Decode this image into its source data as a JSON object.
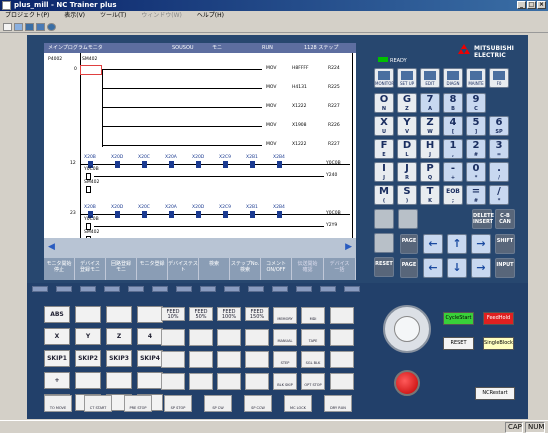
{
  "window": {
    "title": "plus_mill - NC Trainer plus",
    "buttons": [
      "_",
      "□",
      "×"
    ]
  },
  "menu": [
    "プロジェクト(P)",
    "表示(V)",
    "ツール(T)",
    "ウィンドウ(W)",
    "ヘルプ(H)"
  ],
  "screen": {
    "header": {
      "left": "メインプログラムモニタ",
      "sousou": "SOUSOU",
      "mode": "モニ",
      "run": "RUN",
      "step": "1128 ステップ"
    },
    "program_label": "P4002",
    "rungs": [
      {
        "num": "0",
        "contact": "SM402",
        "instr": "MOV",
        "src": "H8FFFF",
        "dst": "R224"
      },
      {
        "num": "",
        "contact": "",
        "instr": "MOV",
        "src": "H4131",
        "dst": "R225"
      },
      {
        "num": "",
        "contact": "",
        "instr": "MOV",
        "src": "X1222",
        "dst": "R227"
      },
      {
        "num": "",
        "contact": "",
        "instr": "MOV",
        "src": "X1908",
        "dst": "R226"
      },
      {
        "num": "",
        "contact": "",
        "instr": "MOV",
        "src": "X1222",
        "dst": "R227"
      },
      {
        "num": "12",
        "contacts": [
          "X20B",
          "X20D",
          "X20C",
          "X20A",
          "X20D",
          "X2C9",
          "X2B1",
          "X2B4"
        ],
        "coil": "Y0C0B"
      },
      {
        "num": "",
        "contacts": [
          "Y0C0B"
        ],
        "coil": "Y240"
      },
      {
        "num": "",
        "contacts": [
          "SM402"
        ]
      },
      {
        "num": "23",
        "contacts": [
          "X20B",
          "X20D",
          "X20C",
          "X20A",
          "X20D",
          "X2C9",
          "X2B1",
          "X2B4"
        ],
        "coil": "Y0C0B"
      },
      {
        "num": "",
        "contacts": [
          "Y0C0B"
        ],
        "coil": "Y2Y9"
      },
      {
        "num": "",
        "contacts": [
          "SM402"
        ]
      },
      {
        "num": "33",
        "contacts": [
          "X20B",
          "X20D",
          "X20C",
          "X20A",
          "X20D",
          "X2C9",
          "X2B1",
          "X2B4"
        ],
        "coil": "M500"
      }
    ],
    "softkeys": [
      "モニタ開始\n停止",
      "デバイス\n登録モニ",
      "回路登録\nモニ",
      "モニタ登録",
      "デバイステスト",
      "検索",
      "ステップNo.\n検索",
      "コメント\nON/OFF",
      "伝送開始\n確認",
      "デバイス\n一括"
    ]
  },
  "status": {
    "ready": "READY"
  },
  "brand": {
    "name": "MITSUBISHI",
    "sub": "ELECTRIC"
  },
  "function_keys": [
    "MONITOR",
    "SET UP",
    "EDIT",
    "DIAGN",
    "MAINTE",
    "F0"
  ],
  "keypad": [
    {
      "main": "O",
      "sub": "N"
    },
    {
      "main": "G",
      "sub": "Z"
    },
    {
      "main": "7",
      "sub": "A"
    },
    {
      "main": "8",
      "sub": "B"
    },
    {
      "main": "9",
      "sub": "C"
    },
    {
      "main": "X",
      "sub": "U"
    },
    {
      "main": "Y",
      "sub": "V"
    },
    {
      "main": "Z",
      "sub": "W"
    },
    {
      "main": "4",
      "sub": "["
    },
    {
      "main": "5",
      "sub": "]"
    },
    {
      "main": "6",
      "sub": "SP"
    },
    {
      "main": "F",
      "sub": "E"
    },
    {
      "main": "D",
      "sub": "L"
    },
    {
      "main": "H",
      "sub": "J"
    },
    {
      "main": "1",
      "sub": ","
    },
    {
      "main": "2",
      "sub": "#"
    },
    {
      "main": "3",
      "sub": "="
    },
    {
      "main": "I",
      "sub": "J"
    },
    {
      "main": "J",
      "sub": "R"
    },
    {
      "main": "P",
      "sub": "Q"
    },
    {
      "main": "-",
      "sub": "+"
    },
    {
      "main": "0",
      "sub": "*"
    },
    {
      "main": ".",
      "sub": "/"
    },
    {
      "main": "M",
      "sub": "("
    },
    {
      "main": "S",
      "sub": ")"
    },
    {
      "main": "T",
      "sub": "K"
    },
    {
      "main": "EOB",
      "sub": ";"
    },
    {
      "main": "=",
      "sub": "#"
    },
    {
      "main": "/",
      "sub": "*"
    }
  ],
  "edit_keys": [
    "DELETE\nINSERT",
    "C-B\nCAN",
    "SHIFT",
    "RESET",
    "PAGE",
    "PAGE",
    "INPUT"
  ],
  "operation": {
    "abs": "ABS",
    "x": "X",
    "y": "Y",
    "z": "Z",
    "4": "4",
    "skip": [
      "SKIP1",
      "SKIP2",
      "SKIP3",
      "SKIP4"
    ],
    "plus": "+",
    "minus": "-",
    "feed": [
      "FEED\n10%",
      "FEED\n50%",
      "FEED\n100%",
      "FEED\n150%"
    ],
    "rapid": [
      "1%",
      "25%",
      "50%",
      "100%"
    ],
    "modes": [
      "MEMORY",
      "MDI",
      "MANUAL",
      "TAPE",
      "STEP",
      "SGL BLK",
      "BLK SKIP",
      "OPT STOP"
    ],
    "misc": [
      "TO MOVE",
      "CT START",
      "PRE STOP",
      "SP STOP",
      "SP CW",
      "SP CCW",
      "MC LOCK",
      "DRY RUN"
    ]
  },
  "side_buttons": {
    "cycle_start": "CycleStart",
    "feed_hold": "FeedHold",
    "reset": "RESET",
    "single_block": "SingleBlock",
    "nc_restart": "NCRestart"
  },
  "statusbar": {
    "cap": "CAP",
    "num": "NUM"
  },
  "colors": {
    "panel": "#27476f",
    "cycle_start": "#39d039",
    "feed_hold": "#e02020",
    "single_block": "#ffffc0"
  }
}
